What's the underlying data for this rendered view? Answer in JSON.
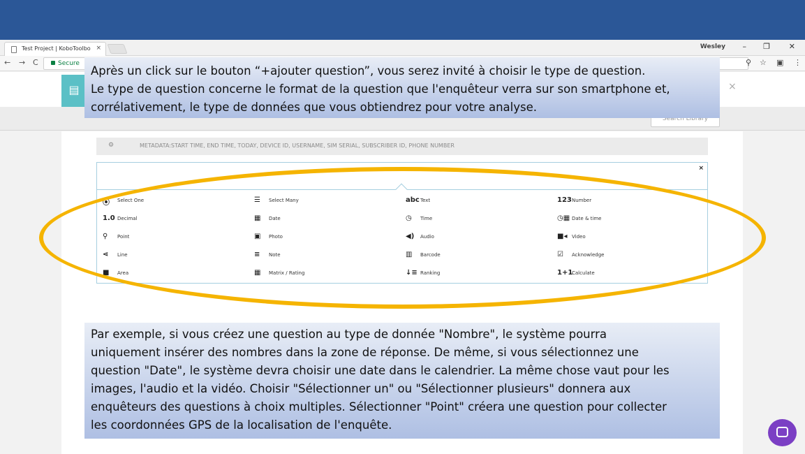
{
  "browser": {
    "tab_title": "Test Project | KoboToolbo",
    "tab_close": "×",
    "user": "Wesley",
    "win_min": "–",
    "win_restore": "❐",
    "win_close": "✕",
    "nav_back": "←",
    "nav_fwd": "→",
    "nav_reload": "C",
    "secure_label": "Secure",
    "icon_zoom": "⚲",
    "icon_star": "☆",
    "icon_menu": "⋮"
  },
  "app": {
    "close_x": "×",
    "search_library": "Search Library"
  },
  "metadata": {
    "gear": "⚙",
    "text": "METADATA:START TIME, END TIME, TODAY, DEVICE ID, USERNAME, SIM SERIAL, SUBSCRIBER ID, PHONE NUMBER"
  },
  "question_types": {
    "close": "×",
    "items": [
      {
        "icon": "⦿",
        "label": "Select One"
      },
      {
        "icon": "☰",
        "label": "Select Many"
      },
      {
        "icon": "abc",
        "label": "Text"
      },
      {
        "icon": "123",
        "label": "Number"
      },
      {
        "icon": "1.0",
        "label": "Decimal"
      },
      {
        "icon": "▦",
        "label": "Date"
      },
      {
        "icon": "◷",
        "label": "Time"
      },
      {
        "icon": "◷▦",
        "label": "Date & time"
      },
      {
        "icon": "⚲",
        "label": "Point"
      },
      {
        "icon": "▣",
        "label": "Photo"
      },
      {
        "icon": "◀)",
        "label": "Audio"
      },
      {
        "icon": "■◂",
        "label": "Video"
      },
      {
        "icon": "⋖",
        "label": "Line"
      },
      {
        "icon": "≡",
        "label": "Note"
      },
      {
        "icon": "▥",
        "label": "Barcode"
      },
      {
        "icon": "☑",
        "label": "Acknowledge"
      },
      {
        "icon": "■",
        "label": "Area"
      },
      {
        "icon": "▦",
        "label": "Matrix / Rating"
      },
      {
        "icon": "↓≡",
        "label": "Ranking"
      },
      {
        "icon": "1+1",
        "label": "Calculate"
      }
    ]
  },
  "callout_top": {
    "line1": "Après un click sur le bouton  “+ajouter question”, vous serez invité à choisir le type de question.",
    "line2": "Le type de question concerne le format de la question que l'enquêteur verra sur son smartphone et,",
    "line3": "corrélativement, le type de données que vous obtiendrez pour votre analyse."
  },
  "callout_bottom": {
    "line1": "Par exemple, si vous créez une question au type de donnée \"Nombre\", le système pourra",
    "line2": "uniquement insérer des nombres dans la zone de réponse. De même, si vous sélectionnez une",
    "line3": "question \"Date\", le système devra choisir une date dans le calendrier. La même chose vaut pour les",
    "line4": "images, l'audio et la vidéo. Choisir \"Sélectionner un\" ou \"Sélectionner plusieurs\" donnera aux",
    "line5": "enquêteurs des questions à choix multiples. Sélectionner \"Point\" créera une question pour collecter",
    "line6": "les coordonnées GPS de la localisation de l'enquête."
  },
  "colors": {
    "top_band": "#2b5797",
    "highlight_ellipse": "#f5b400",
    "chat_button": "#7b3fc4"
  }
}
